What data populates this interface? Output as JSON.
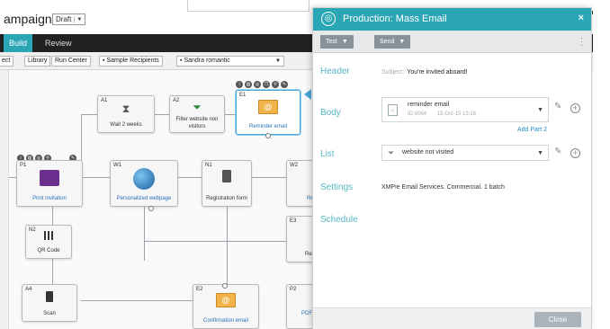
{
  "campaign": {
    "title": "ampaign",
    "status": "Draft"
  },
  "tabs": [
    {
      "label": "Build"
    },
    {
      "label": "Review"
    }
  ],
  "toolbar": {
    "buttons": [
      {
        "label": "ect"
      },
      {
        "label": "Library"
      },
      {
        "label": "Run Center"
      },
      {
        "label": "Sample Recipients"
      }
    ],
    "recipient_select": "Sandra romantic"
  },
  "nodes": {
    "A1": {
      "id": "A1",
      "label": "Wait 2 weeks"
    },
    "A2": {
      "id": "A2",
      "label": "Filter website non visitors"
    },
    "E1": {
      "id": "E1",
      "label": "Reminder email"
    },
    "P1": {
      "id": "P1",
      "label": "Print invitation"
    },
    "W1": {
      "id": "W1",
      "label": "Personalized webpage"
    },
    "N1": {
      "id": "N1",
      "label": "Registration form"
    },
    "W2": {
      "id": "W2",
      "label": "Re"
    },
    "N2": {
      "id": "N2",
      "label": "QR Code"
    },
    "E3": {
      "id": "E3",
      "label": "Ref"
    },
    "A4": {
      "id": "A4",
      "label": "Scan"
    },
    "E2": {
      "id": "E2",
      "label": "Confirmation email"
    },
    "P2": {
      "id": "P2",
      "label": "PDF"
    }
  },
  "panel": {
    "title": "Production: Mass Email",
    "close_glyph": "×",
    "test_label": "Test",
    "send_label": "Send",
    "rows": {
      "header": "Header",
      "body": "Body",
      "list": "List",
      "settings": "Settings",
      "schedule": "Schedule"
    },
    "header_prefix": "Subject:",
    "header_value": "You're invited aboard!",
    "body_doc_name": "reminder email",
    "body_doc_id": "ID:6064",
    "body_doc_date": "13-Oct-15 13:16",
    "add_part": "Add Part 2",
    "list_value": "website not visited",
    "settings_value": "XMPie Email Services. Commercial. 1 batch",
    "close_button": "Close"
  },
  "colors": {
    "accent": "#2aa6b5",
    "label": "#57b7c3",
    "link": "#2a8cc8"
  }
}
